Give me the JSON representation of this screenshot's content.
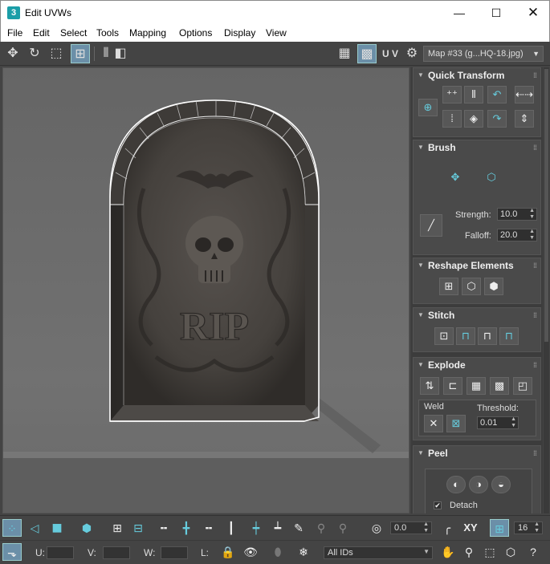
{
  "window": {
    "app_icon": "3",
    "title": "Edit UVWs",
    "minimize": "—",
    "maximize": "☐",
    "close": "✕"
  },
  "menu": [
    "File",
    "Edit",
    "Select",
    "Tools",
    "Mapping",
    "Options",
    "Display",
    "View"
  ],
  "toolbar": {
    "uv_label": "U V",
    "map_select": "Map #33 (g...HQ-18.jpg)"
  },
  "viewport": {
    "image_subject": "tombstone-texture",
    "engraving": "RIP"
  },
  "panel": {
    "quick_transform": {
      "title": "Quick Transform"
    },
    "brush": {
      "title": "Brush",
      "strength_label": "Strength:",
      "strength_value": "10.0",
      "falloff_label": "Falloff:",
      "falloff_value": "20.0"
    },
    "reshape": {
      "title": "Reshape Elements"
    },
    "stitch": {
      "title": "Stitch"
    },
    "explode": {
      "title": "Explode",
      "weld_label": "Weld",
      "threshold_label": "Threshold:",
      "threshold_value": "0.01"
    },
    "peel": {
      "title": "Peel",
      "detach_label": "Detach",
      "detach_checked": true
    }
  },
  "bottom": {
    "rotation_value": "0.0",
    "xy_label": "XY",
    "grid_value": "16",
    "u_label": "U:",
    "v_label": "V:",
    "w_label": "W:",
    "l_label": "L:",
    "ids_select": "All IDs"
  },
  "colors": {
    "accent": "#6cd",
    "active_button": "#6b8fa8",
    "panel_bg": "#3c3c3c",
    "rollout_bg": "#4a4a4a"
  }
}
